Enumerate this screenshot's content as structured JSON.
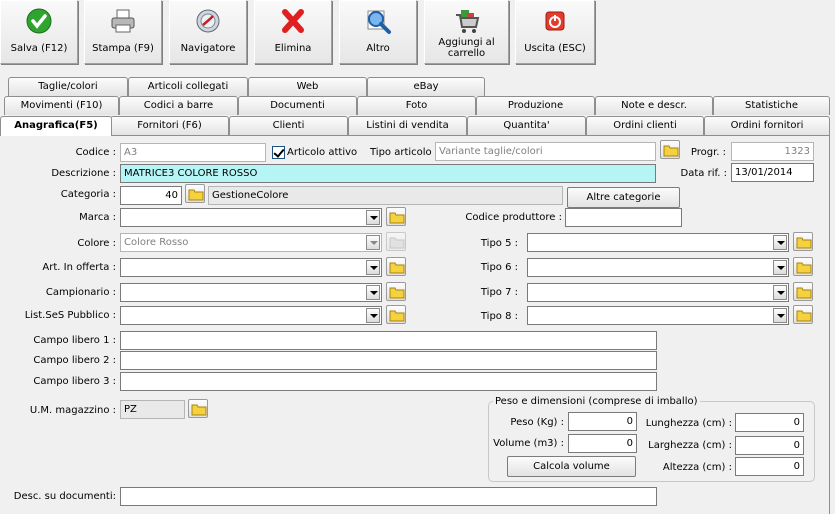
{
  "toolbar": {
    "salva": "Salva (F12)",
    "stampa": "Stampa (F9)",
    "navigatore": "Navigatore",
    "elimina": "Elimina",
    "altro": "Altro",
    "aggiungi_line1": "Aggiungi al",
    "aggiungi_line2": "carrello",
    "uscita": "Uscita (ESC)"
  },
  "tabs": {
    "row1": [
      "Taglie/colori",
      "Articoli collegati",
      "Web",
      "eBay"
    ],
    "row2": [
      "Movimenti (F10)",
      "Codici a barre",
      "Documenti",
      "Foto",
      "Produzione",
      "Note e descr.",
      "Statistiche"
    ],
    "row3": [
      "Anagrafica(F5)",
      "Fornitori (F6)",
      "Clienti",
      "Listini di vendita",
      "Quantita'",
      "Ordini clienti",
      "Ordini fornitori"
    ]
  },
  "form": {
    "codice_label": "Codice :",
    "codice_value": "A3",
    "articolo_attivo_label": "Articolo attivo",
    "tipo_articolo_label": "Tipo articolo :",
    "tipo_articolo_value": "Variante taglie/colori",
    "progr_label": "Progr. :",
    "progr_value": "1323",
    "descrizione_label": "Descrizione :",
    "descrizione_value": "MATRICE3 COLORE ROSSO",
    "data_rif_label": "Data rif. :",
    "data_rif_value": "13/01/2014",
    "categoria_label": "Categoria :",
    "categoria_code": "40",
    "categoria_name": "GestioneColore",
    "altre_categorie": "Altre categorie",
    "marca_label": "Marca :",
    "marca_value": "",
    "codice_produttore_label": "Codice produttore :",
    "codice_produttore_value": "",
    "colore_label": "Colore :",
    "colore_value": "Colore Rosso",
    "art_offerta_label": "Art. In offerta :",
    "campionario_label": "Campionario :",
    "list_pubblico_label": "List.SeS Pubblico :",
    "tipo5_label": "Tipo 5 :",
    "tipo6_label": "Tipo 6 :",
    "tipo7_label": "Tipo 7 :",
    "tipo8_label": "Tipo 8 :",
    "campo1_label": "Campo libero 1 :",
    "campo2_label": "Campo libero 2 :",
    "campo3_label": "Campo libero 3 :",
    "um_label": "U.M. magazzino :",
    "um_value": "PZ",
    "desc_doc_label": "Desc. su documenti:"
  },
  "peso": {
    "title": "Peso e dimensioni (comprese di imballo)",
    "peso_label": "Peso (Kg) :",
    "peso_value": "0",
    "volume_label": "Volume (m3) :",
    "volume_value": "0",
    "calcola": "Calcola volume",
    "lunghezza_label": "Lunghezza (cm) :",
    "lunghezza_value": "0",
    "larghezza_label": "Larghezza (cm) :",
    "larghezza_value": "0",
    "altezza_label": "Altezza (cm) :",
    "altezza_value": "0"
  }
}
